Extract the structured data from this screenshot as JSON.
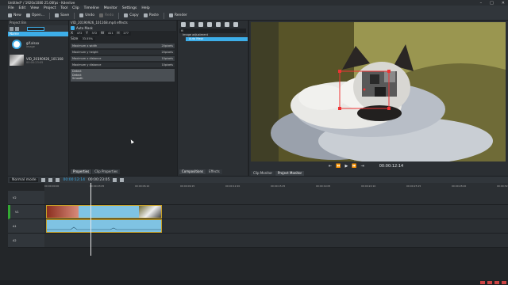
{
  "window": {
    "title": "Untitled* / 1920x1080 25.00fps - Kdenlive"
  },
  "menu": [
    "File",
    "Edit",
    "View",
    "Project",
    "Tool",
    "Clip",
    "Timeline",
    "Monitor",
    "Settings",
    "Help"
  ],
  "toolbar": {
    "new": "New",
    "open": "Open...",
    "save": "Save",
    "undo": "Undo",
    "redo": "Redo",
    "copy": "Copy",
    "paste": "Paste",
    "render": "Render"
  },
  "bin": {
    "title": "Project Bin",
    "column": "Name",
    "search_label": "Filter",
    "clips": [
      {
        "name": "gif.xlsxx",
        "sub": "image"
      },
      {
        "name": "VID_20190926_101168",
        "sub": "00:00:23:05"
      }
    ]
  },
  "props": {
    "title": "VID_20190926_101168.mp4 effects",
    "effect": "Auto Mask",
    "fields": [
      "X",
      "472",
      "Y",
      "372",
      "W",
      "411",
      "H",
      "277"
    ],
    "size": "Size",
    "size_val": "33.55%",
    "sliders": [
      {
        "label": "Maximum x width",
        "value": "20pixels"
      },
      {
        "label": "Maximum y height",
        "value": "20pixels"
      },
      {
        "label": "Maximum x distance",
        "value": "10pixels"
      },
      {
        "label": "Maximum y distance",
        "value": "10pixels"
      }
    ],
    "list": [
      "Detect",
      "Detect",
      "Smooth"
    ],
    "tabs": [
      "Properties",
      "Clip Properties"
    ]
  },
  "comp": {
    "search": "fil",
    "tree_parent": "Image adjustment",
    "tree_child": "Auto Mask",
    "tabs": [
      "Compositions",
      "Effects"
    ]
  },
  "monitor": {
    "timecode": "00:00:12:14",
    "tabs": [
      "Clip Monitor",
      "Project Monitor"
    ]
  },
  "timeline": {
    "mode": "Normal mode",
    "timecode": "00:00:12:14",
    "total": "00:00:23:05",
    "tracks": [
      "V2",
      "V1",
      "A1",
      "A2"
    ],
    "ruler": [
      "00:00:00:00",
      "00:00:03:05",
      "00:00:06:10",
      "00:00:09:15",
      "00:00:12:20",
      "00:00:15:25",
      "00:00:19:05",
      "00:00:22:10",
      "00:00:25:15",
      "00:00:28:20",
      "00:00:32:00"
    ]
  },
  "colors": {
    "accent": "#3daee9",
    "clip": "#7fc3e3",
    "clip_border": "#c9a227",
    "mask": "#e33"
  }
}
